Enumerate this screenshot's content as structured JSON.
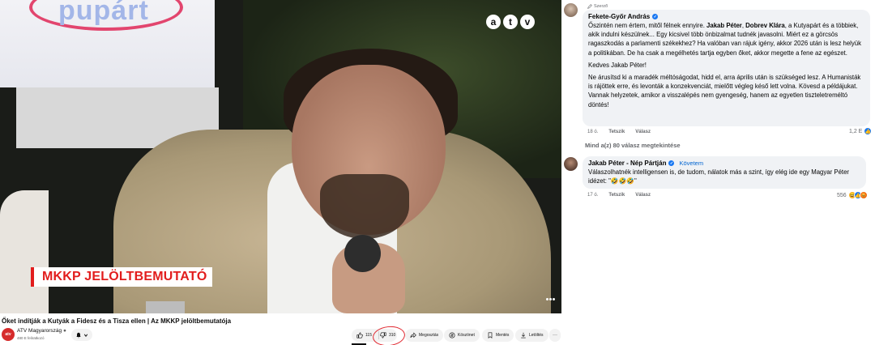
{
  "video": {
    "bg_word": "pupárt",
    "logo_letters": [
      "a",
      "t",
      "v"
    ],
    "lower_third": "MKKP JELÖLTBEMUTATÓ",
    "title": "Őket indítják a Kutyák a Fidesz és a Tisza ellen | Az MKKP jelöltbemutatója",
    "channel_name": "ATV Magyarország",
    "channel_subs": "480 E feliratkozó",
    "channel_avatar_text": "atv",
    "actions": {
      "like_count": "115",
      "dislike_count": "310",
      "share": "Megosztás",
      "thanks": "Köszönet",
      "save": "Mentés",
      "download": "Letöltés",
      "more": "···"
    },
    "accent_color": "#e21d1d",
    "circle_color": "#e0262e"
  },
  "comments": {
    "author_label": "Szerző",
    "first": {
      "name": "Fekete-Győr András",
      "p1_parts": [
        "Őszintén nem értem, mitől félnek ennyire. ",
        "Jakab Péter",
        ", ",
        "Dobrev Klára",
        ", a Kutyapárt és a többiek, akik indulni készülnek... Egy kicsivel több önbizalmat tudnék javasolni. Miért ez a görcsös ragaszkodás a parlamenti székekhez? Ha valóban van rájuk igény, akkor 2026 után is lesz helyük a politikában. De ha csak a megélhetés tartja egyben őket, akkor megette a fene az egészet."
      ],
      "p2": "Kedves Jakab Péter!",
      "p3": "Ne árusítsd ki a maradék méltóságodat, hidd el, arra április után is szükséged lesz. A Humanisták is rájöttek erre, és levonták a konzekvenciát, mielőtt végleg késő lett volna. Kövesd a példájukat. Vannak helyzetek, amikor a visszalépés nem gyengeség, hanem az egyetlen tiszteletreméltó döntés!",
      "time": "18 ó.",
      "like": "Tetszik",
      "reply": "Válasz",
      "reactions_count": "1,2 E"
    },
    "more_replies": "Mind a(z) 80 válasz megtekintése",
    "second": {
      "name": "Jakab Péter - Nép Pártján",
      "follow": "Követem",
      "text": "Válaszolhatnék intelligensen is, de tudom, nálatok más a szint, így elég ide egy Magyar Péter idézet: \"",
      "emoji": "🤣🤣🤣",
      "text_end": "\"",
      "time": "17 ó.",
      "like": "Tetszik",
      "reply": "Válasz",
      "reactions_count": "556"
    },
    "reaction_colors": {
      "like": "#1877f2",
      "haha": "#f7b125",
      "angry": "#e9710f"
    }
  }
}
